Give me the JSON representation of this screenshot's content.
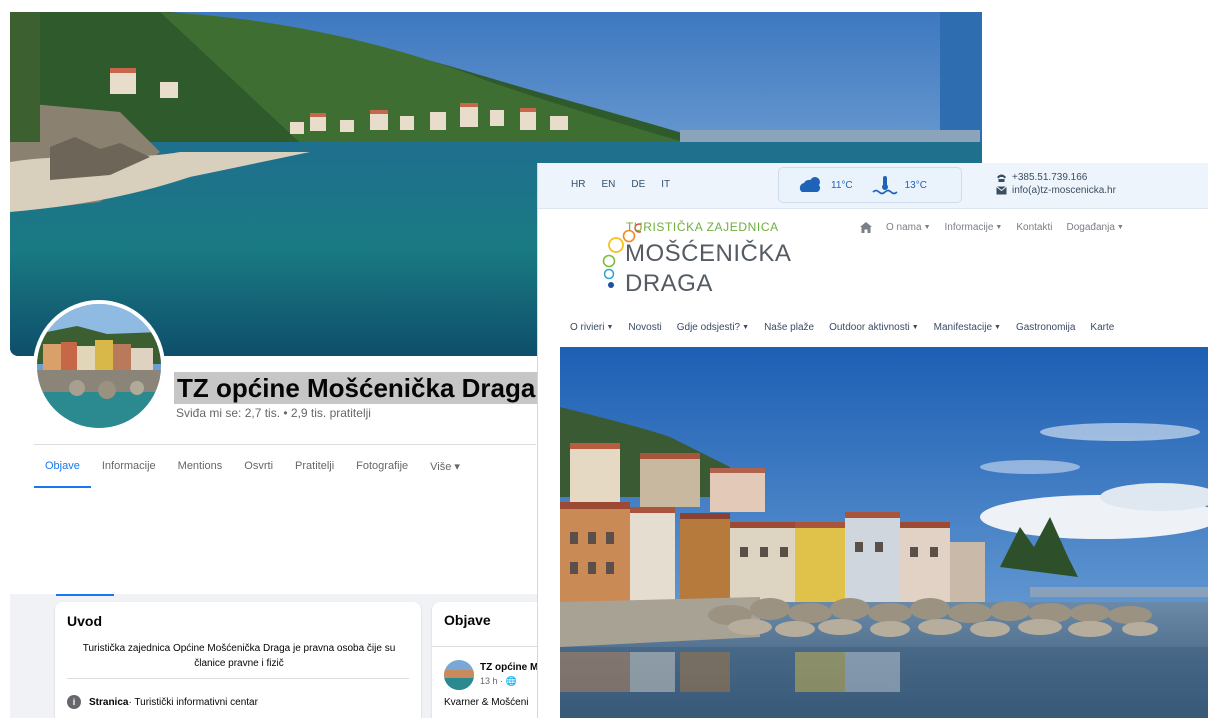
{
  "facebook": {
    "page_name": "TZ općine Mošćenička Draga",
    "stats": "Sviđa mi se: 2,7 tis. • 2,9 tis. pratitelji",
    "tabs": [
      {
        "label": "Objave",
        "active": true
      },
      {
        "label": "Informacije"
      },
      {
        "label": "Mentions"
      },
      {
        "label": "Osvrti"
      },
      {
        "label": "Pratitelji"
      },
      {
        "label": "Fotografije"
      },
      {
        "label": "Više ▾"
      }
    ],
    "intro": {
      "title": "Uvod",
      "text": "Turistička zajednica Općine Mošćenička Draga je pravna osoba čije su članice pravne i fizič",
      "page_category_label": "Stranica",
      "page_category_value": " · Turistički informativni centar"
    },
    "posts": {
      "title": "Objave",
      "author": "TZ općine M",
      "time": "13 h · 🌐",
      "text": "Kvarner & Mošćeni"
    },
    "accent_color": "#1877f2"
  },
  "site": {
    "languages": [
      "HR",
      "EN",
      "DE",
      "IT"
    ],
    "weather": {
      "air_temp": "11°C",
      "sea_temp": "13°C",
      "weather_icon": "cloud-sun-icon",
      "sea_icon": "sea-temperature-icon"
    },
    "contact": {
      "phone": "+385.51.739.166",
      "email": "info(a)tz-moscenicka.hr"
    },
    "brand": {
      "top": "TURISTIČKA ZAJEDNICA",
      "line1": "MOŠĆENIČKA",
      "line2": "DRAGA"
    },
    "main_nav": [
      {
        "label": "O nama",
        "dropdown": true
      },
      {
        "label": "Informacije",
        "dropdown": true
      },
      {
        "label": "Kontakti",
        "dropdown": false
      },
      {
        "label": "Događanja",
        "dropdown": true
      }
    ],
    "sub_nav": [
      {
        "label": "O rivieri",
        "dropdown": true
      },
      {
        "label": "Novosti",
        "dropdown": false
      },
      {
        "label": "Gdje odsjesti?",
        "dropdown": true
      },
      {
        "label": "Naše plaže",
        "dropdown": false
      },
      {
        "label": "Outdoor aktivnosti",
        "dropdown": true
      },
      {
        "label": "Manifestacije",
        "dropdown": true
      },
      {
        "label": "Gastronomija",
        "dropdown": false
      },
      {
        "label": "Karte",
        "dropdown": false
      }
    ],
    "brand_colors": {
      "green": "#6fae3e",
      "blue": "#1e63b8",
      "gray": "#555b63"
    }
  }
}
